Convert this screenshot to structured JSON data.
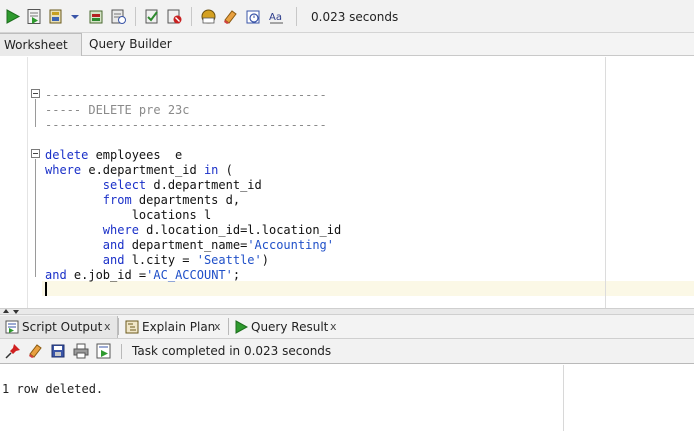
{
  "toolbar": {
    "elapsed": "0.023 seconds",
    "icons": [
      "run-statement-icon",
      "run-script-icon",
      "commit-icon",
      "rollback-icon",
      "sql-history-icon",
      "explain-plan-icon",
      "autotrace-icon",
      "sql-tuning-icon",
      "clear-icon",
      "unshared-worksheet-icon",
      "format-text-icon"
    ]
  },
  "worksheet_tabs": {
    "worksheet": "Worksheet",
    "query_builder": "Query Builder"
  },
  "editor": {
    "lines": [
      [],
      [],
      [
        {
          "t": "---------------------------------------",
          "c": "cm"
        }
      ],
      [
        {
          "t": "----- DELETE pre 23c",
          "c": "cm"
        }
      ],
      [
        {
          "t": "---------------------------------------",
          "c": "cm"
        }
      ],
      [],
      [
        {
          "t": "delete",
          "c": "kw"
        },
        {
          "t": " employees  e",
          "c": "pl"
        }
      ],
      [
        {
          "t": "where",
          "c": "kw"
        },
        {
          "t": " e.department_id ",
          "c": "pl"
        },
        {
          "t": "in",
          "c": "kw"
        },
        {
          "t": " (",
          "c": "pl"
        }
      ],
      [
        {
          "t": "        ",
          "c": "pl"
        },
        {
          "t": "select",
          "c": "kw"
        },
        {
          "t": " d.department_id",
          "c": "pl"
        }
      ],
      [
        {
          "t": "        ",
          "c": "pl"
        },
        {
          "t": "from",
          "c": "kw"
        },
        {
          "t": " departments d,",
          "c": "pl"
        }
      ],
      [
        {
          "t": "            locations l",
          "c": "pl"
        }
      ],
      [
        {
          "t": "        ",
          "c": "pl"
        },
        {
          "t": "where",
          "c": "kw"
        },
        {
          "t": " d.location_id=l.location_id",
          "c": "pl"
        }
      ],
      [
        {
          "t": "        ",
          "c": "pl"
        },
        {
          "t": "and",
          "c": "kw"
        },
        {
          "t": " department_name=",
          "c": "pl"
        },
        {
          "t": "'Accounting'",
          "c": "str"
        }
      ],
      [
        {
          "t": "        ",
          "c": "pl"
        },
        {
          "t": "and",
          "c": "kw"
        },
        {
          "t": " l.city = ",
          "c": "pl"
        },
        {
          "t": "'Seattle'",
          "c": "str"
        },
        {
          "t": ")",
          "c": "pl"
        }
      ],
      [
        {
          "t": "and",
          "c": "kw"
        },
        {
          "t": " e.job_id =",
          "c": "pl"
        },
        {
          "t": "'AC_ACCOUNT'",
          "c": "str"
        },
        {
          "t": ";",
          "c": "pl"
        }
      ],
      []
    ]
  },
  "output_tabs": {
    "script_output": "Script Output",
    "explain_plan": "Explain Plan",
    "query_result": "Query Result",
    "close_glyph": "x"
  },
  "output_toolbar": {
    "message": "Task completed in 0.023 seconds"
  },
  "output": {
    "text": "1 row deleted."
  },
  "colors": {
    "keyword": "#1a30c8",
    "comment": "#8a8a8a",
    "string": "#2050c8",
    "run_green": "#2e9a2e"
  }
}
